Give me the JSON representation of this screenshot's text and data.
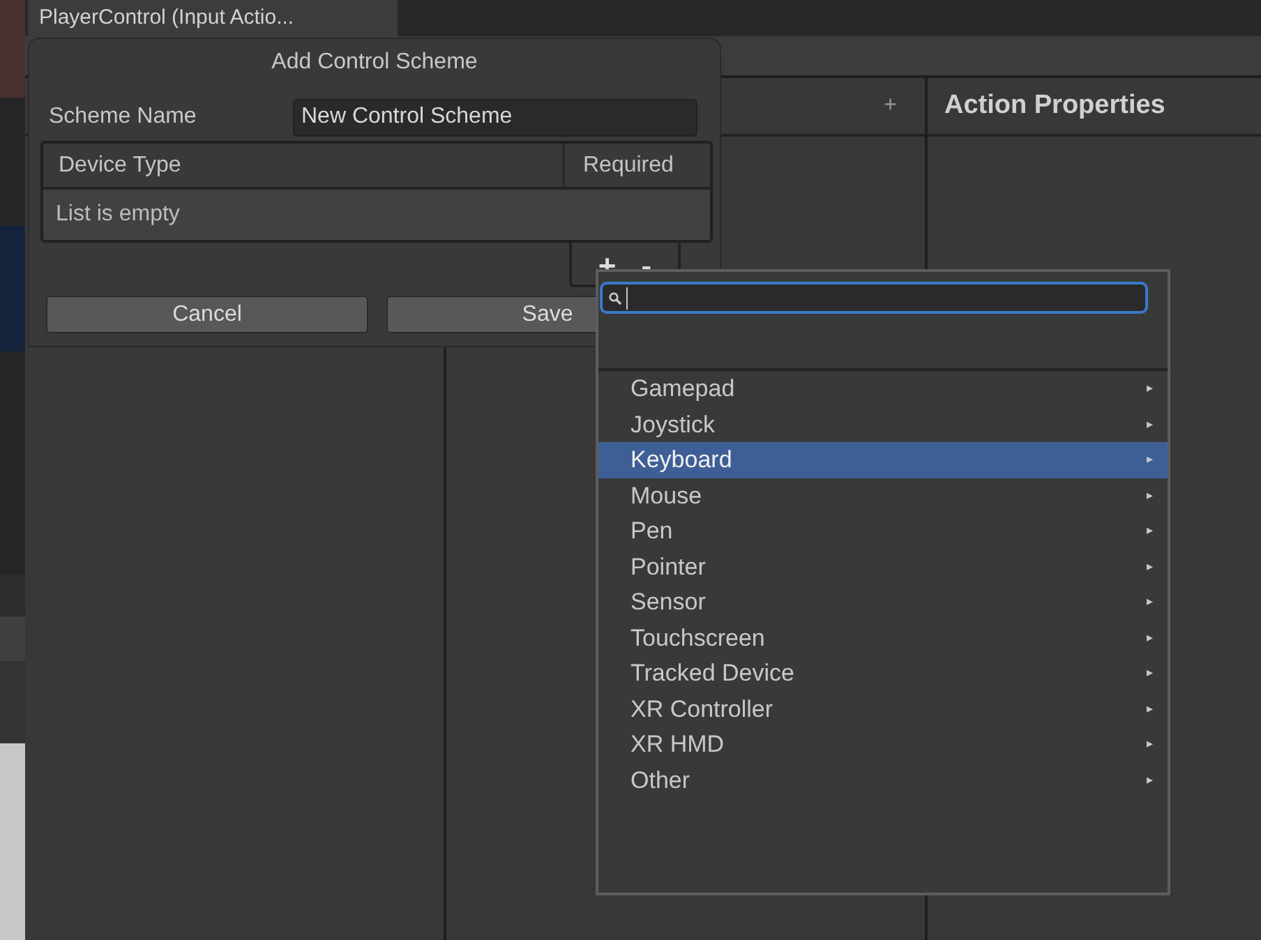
{
  "window": {
    "tab_title": "PlayerControl (Input Actio..."
  },
  "panels": {
    "actions_add": "+",
    "properties_title": "Action Properties"
  },
  "dialog": {
    "title": "Add Control Scheme",
    "scheme_name_label": "Scheme Name",
    "scheme_name_value": "New Control Scheme",
    "table": {
      "columns": [
        "Device Type",
        "Required"
      ],
      "empty_text": "List is empty"
    },
    "add_button": "+",
    "remove_button": "-",
    "buttons": [
      "Cancel",
      "Save"
    ]
  },
  "dropdown": {
    "items": [
      {
        "label": "Gamepad",
        "selected": false,
        "arrow": "▸"
      },
      {
        "label": "Joystick",
        "selected": false,
        "arrow": "▸"
      },
      {
        "label": "Keyboard",
        "selected": true,
        "arrow": "▸"
      },
      {
        "label": "Mouse",
        "selected": false,
        "arrow": "▸"
      },
      {
        "label": "Pen",
        "selected": false,
        "arrow": "▸"
      },
      {
        "label": "Pointer",
        "selected": false,
        "arrow": "▸"
      },
      {
        "label": "Sensor",
        "selected": false,
        "arrow": "▸"
      },
      {
        "label": "Touchscreen",
        "selected": false,
        "arrow": "▸"
      },
      {
        "label": "Tracked Device",
        "selected": false,
        "arrow": "▸"
      },
      {
        "label": "XR Controller",
        "selected": false,
        "arrow": "▸"
      },
      {
        "label": "XR HMD",
        "selected": false,
        "arrow": "▸"
      },
      {
        "label": "Other",
        "selected": false,
        "arrow": "▸"
      }
    ]
  }
}
